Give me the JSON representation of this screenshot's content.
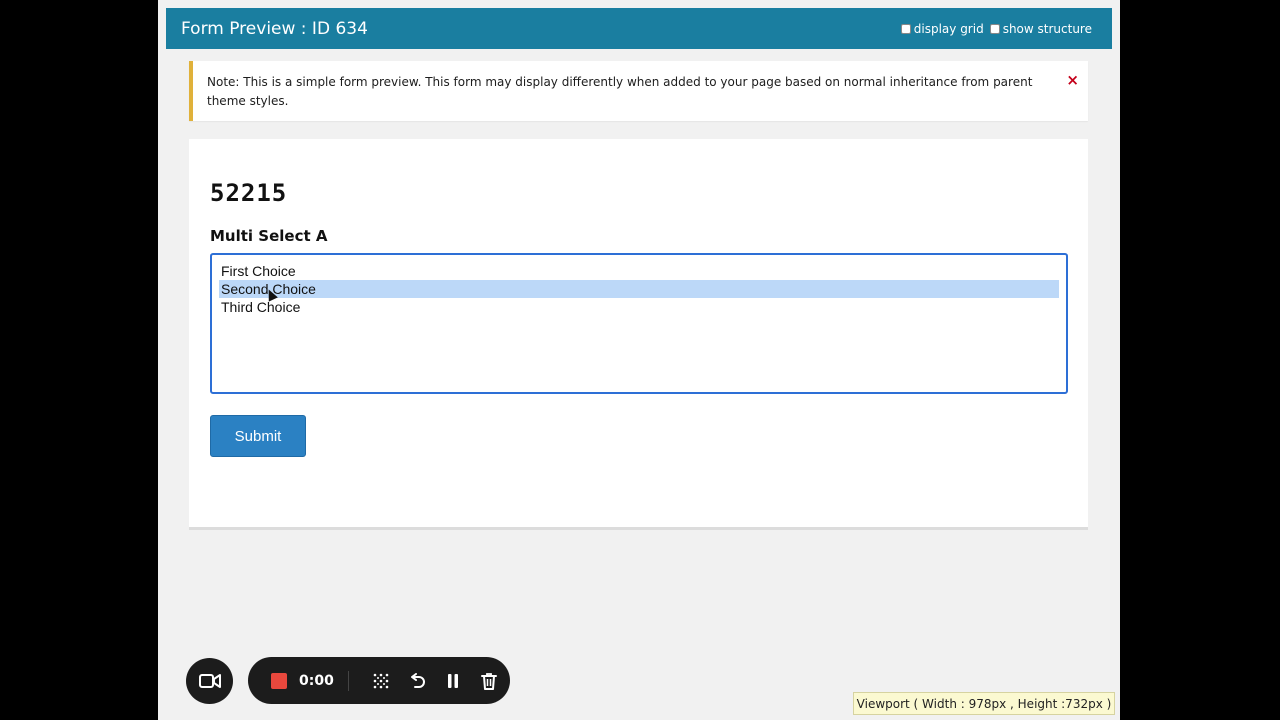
{
  "header": {
    "title": "Form Preview : ID 634",
    "option_display_grid": "display grid",
    "option_show_structure": "show structure"
  },
  "notice": {
    "text": "Note: This is a simple form preview. This form may display differently when added to your page based on normal inheritance from parent theme styles.",
    "close": "×"
  },
  "form": {
    "title": "52215",
    "field_label": "Multi Select A",
    "options": [
      {
        "label": "First Choice",
        "selected": false
      },
      {
        "label": "Second Choice",
        "selected": true
      },
      {
        "label": "Third Choice",
        "selected": false
      }
    ],
    "submit_label": "Submit"
  },
  "recorder": {
    "timer": "0:00"
  },
  "viewport_info": "Viewport ( Width : 978px , Height :732px )",
  "colors": {
    "header_bg": "#1a7ea0",
    "accent_button": "#2b81c3",
    "selected_option": "#bcd8f8",
    "notice_border": "#e0b13a",
    "close_x": "#c4001a",
    "record_stop": "#e8483d"
  }
}
